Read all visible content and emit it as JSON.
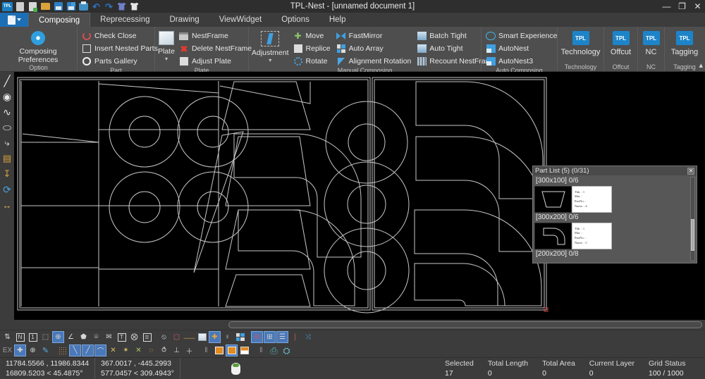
{
  "window": {
    "title": "TPL-Nest - [unnamed document 1]",
    "quick_access": [
      {
        "name": "tpl-logo-icon",
        "label": "TPL"
      },
      {
        "name": "new-document-icon",
        "label": "New"
      },
      {
        "name": "new-part-icon",
        "label": "New Part"
      },
      {
        "name": "open-folder-icon",
        "label": "Open"
      },
      {
        "name": "save-icon",
        "label": "Save"
      },
      {
        "name": "save-as-icon",
        "label": "Save As"
      },
      {
        "name": "print-icon",
        "label": "Print"
      },
      {
        "name": "undo-icon",
        "label": "Undo"
      },
      {
        "name": "redo-icon",
        "label": "Redo"
      },
      {
        "name": "import-icon",
        "label": "Import"
      },
      {
        "name": "export-icon",
        "label": "Export"
      }
    ],
    "controls": {
      "minimize": "—",
      "restore": "❐",
      "close": "✕"
    }
  },
  "tabs": [
    {
      "label": "Composing",
      "active": true
    },
    {
      "label": "Reprecessing",
      "active": false
    },
    {
      "label": "Drawing",
      "active": false
    },
    {
      "label": "ViewWidget",
      "active": false
    },
    {
      "label": "Options",
      "active": false
    },
    {
      "label": "Help",
      "active": false
    }
  ],
  "ribbon": {
    "groups": [
      {
        "title": "Option",
        "big": {
          "label": "Composing Preferences",
          "icon": "gear-icon"
        }
      },
      {
        "title": "Part",
        "items": [
          {
            "label": "Check Close",
            "icon": "circular-arrow-icon"
          },
          {
            "label": "Insert Nested Parts",
            "icon": "insert-parts-icon"
          },
          {
            "label": "Parts Gallery",
            "icon": "ring-icon"
          }
        ]
      },
      {
        "title": "Plate",
        "big": {
          "label": "Plate",
          "icon": "plate-icon"
        },
        "items": [
          {
            "label": "NestFrame",
            "icon": "nestframe-icon"
          },
          {
            "label": "Delete NestFrame",
            "icon": "delete-x-icon"
          },
          {
            "label": "Adjust Plate",
            "icon": "adjust-plate-icon"
          }
        ]
      },
      {
        "title": "Manual Composing",
        "big": {
          "label": "Adjustment",
          "icon": "adjustment-icon"
        },
        "col1": [
          {
            "label": "Move",
            "icon": "move-icon"
          },
          {
            "label": "Replice",
            "icon": "replice-icon"
          },
          {
            "label": "Rotate",
            "icon": "rotate-icon"
          }
        ],
        "col2": [
          {
            "label": "FastMirror",
            "icon": "mirror-icon"
          },
          {
            "label": "Auto Array",
            "icon": "array-icon"
          },
          {
            "label": "Alignment Rotation",
            "icon": "alignment-rotation-icon"
          }
        ],
        "col3": [
          {
            "label": "Batch Tight",
            "icon": "batch-tight-icon"
          },
          {
            "label": "Auto Tight",
            "icon": "auto-tight-icon"
          },
          {
            "label": "Recount NestFrame",
            "icon": "recount-icon"
          }
        ]
      },
      {
        "title": "Auto Composing",
        "items": [
          {
            "label": "Smart Experience",
            "icon": "cloud-icon"
          },
          {
            "label": "AutoNest",
            "icon": "autonest-icon"
          },
          {
            "label": "AutoNest3",
            "icon": "autonest3-icon"
          }
        ]
      },
      {
        "title": "Technology",
        "tpl": {
          "label": "Technology",
          "badge": "TPL"
        }
      },
      {
        "title": "Offcut",
        "tpl": {
          "label": "Offcut",
          "badge": "TPL"
        }
      },
      {
        "title": "NC",
        "tpl": {
          "label": "NC",
          "badge": "TPL"
        }
      },
      {
        "title": "Tagging",
        "tpl": {
          "label": "Tagging",
          "badge": "TPL"
        }
      }
    ],
    "collapse_icon": "chevron-up-icon"
  },
  "left_toolbar": [
    {
      "name": "line-tool",
      "glyph": "╱"
    },
    {
      "name": "circle-tool",
      "glyph": "◉"
    },
    {
      "name": "spline-tool",
      "glyph": "∿"
    },
    {
      "name": "ellipse-tool",
      "glyph": "⬭"
    },
    {
      "name": "arc-tool",
      "glyph": "⤷"
    },
    {
      "name": "text-tool",
      "glyph": "▤"
    },
    {
      "name": "dimension-tool",
      "glyph": "↧"
    },
    {
      "name": "rotate-tool",
      "glyph": "⟳"
    },
    {
      "name": "measure-tool",
      "glyph": "↔"
    }
  ],
  "part_list": {
    "title": "Part List (5) (0/31)",
    "close_glyph": "✕",
    "groups": [
      {
        "size_label": "[300x100] 0/6",
        "info": {
          "thk": "Thk. :  1",
          "mat": "Mat. :",
          "partno": "PartNo. :",
          "name": "Name. :  4"
        },
        "shape": "trapezoid"
      },
      {
        "size_label": "[300x200] 0/6",
        "info": {
          "thk": "Thk. :  1",
          "mat": "Mat. :",
          "partno": "PartNo. :",
          "name": "Name. :  5"
        },
        "shape": "elbow"
      },
      {
        "size_label": "[200x200] 0/8",
        "info": null,
        "shape": null
      }
    ]
  },
  "bottom_toolbar_row1": [
    {
      "name": "snap-toggle-icon",
      "glyph": "⇅",
      "active": false
    },
    {
      "name": "ortho-n-icon",
      "glyph": "N",
      "active": false
    },
    {
      "name": "layer-1-icon",
      "glyph": "1",
      "active": false
    },
    {
      "name": "selection-box-icon",
      "glyph": "⬚",
      "active": false
    },
    {
      "name": "center-snap-icon",
      "glyph": "⊕",
      "active": true
    },
    {
      "name": "angle-icon",
      "glyph": "∠",
      "active": false
    },
    {
      "name": "polygon-icon",
      "glyph": "⬟",
      "active": false
    },
    {
      "name": "tag-box-icon",
      "glyph": "⌾",
      "active": false
    },
    {
      "name": "envelope-icon",
      "glyph": "✉",
      "active": false
    },
    {
      "name": "text-box-icon",
      "glyph": "T",
      "active": false
    },
    {
      "name": "crosshair-circle-icon",
      "glyph": "⨂",
      "active": false
    },
    {
      "name": "table-icon",
      "glyph": "≣",
      "active": false
    },
    {
      "name": "hide-icon",
      "glyph": "⦸",
      "active": false
    },
    {
      "name": "bbox-icon",
      "glyph": "▢",
      "active": false
    },
    {
      "name": "zigzag-icon",
      "glyph": "⸺",
      "active": false
    },
    {
      "name": "fill-icon",
      "glyph": "■",
      "active": false
    },
    {
      "name": "lead-icon",
      "glyph": "✚",
      "active": true
    },
    {
      "name": "pin-icon",
      "glyph": "♀",
      "active": false
    },
    {
      "name": "grid-blocks-icon",
      "glyph": "∷",
      "active": false
    },
    {
      "name": "no-display-icon",
      "glyph": "⊘",
      "active": true
    },
    {
      "name": "grid-view-icon",
      "glyph": "⊞",
      "active": true
    },
    {
      "name": "note-icon",
      "glyph": "☰",
      "active": true
    },
    {
      "name": "marker-icon",
      "glyph": "❘",
      "active": false
    },
    {
      "name": "shuffle-icon",
      "glyph": "⤨",
      "active": false
    }
  ],
  "bottom_toolbar_row2": [
    {
      "name": "extend-label",
      "glyph": "EX",
      "active": false
    },
    {
      "name": "crosshair-icon",
      "glyph": "✚",
      "active": true
    },
    {
      "name": "target-icon",
      "glyph": "⊕",
      "active": false
    },
    {
      "name": "pencil-icon",
      "glyph": "✎",
      "active": false
    },
    {
      "name": "dot-grid-icon",
      "glyph": "∷",
      "active": false
    },
    {
      "name": "line-snap1-icon",
      "glyph": "╲",
      "active": true
    },
    {
      "name": "line-snap2-icon",
      "glyph": "╱",
      "active": true
    },
    {
      "name": "curve-snap-icon",
      "glyph": "⌒",
      "active": true
    },
    {
      "name": "trim-icon",
      "glyph": "✕",
      "active": false
    },
    {
      "name": "extend-icon",
      "glyph": "✶",
      "active": false
    },
    {
      "name": "intersect-icon",
      "glyph": "✕",
      "active": false
    },
    {
      "name": "circle-snap-icon",
      "glyph": "◌",
      "active": false
    },
    {
      "name": "arc-mid-icon",
      "glyph": "⥀",
      "active": false
    },
    {
      "name": "perp-icon",
      "glyph": "⊥",
      "active": false
    },
    {
      "name": "plus-icon",
      "glyph": "＋",
      "active": false
    },
    {
      "name": "bar-icon",
      "glyph": "‖",
      "active": false
    },
    {
      "name": "orange-box1-icon",
      "glyph": "",
      "active": false
    },
    {
      "name": "orange-box2-icon",
      "glyph": "",
      "active": true
    },
    {
      "name": "orange-box3-icon",
      "glyph": "",
      "active": false
    },
    {
      "name": "ruler-icon",
      "glyph": "‖",
      "active": false
    },
    {
      "name": "machine-icon",
      "glyph": "⎙",
      "active": false
    },
    {
      "name": "building-icon",
      "glyph": "⛭",
      "active": false
    }
  ],
  "status_bar": {
    "coords": {
      "line1": "11784.5566 , 11986.8344",
      "line2": "16809.5203 < 45.4875°"
    },
    "delta": {
      "line1": "367.0017 , -445.2993",
      "line2": "577.0457 < 309.4943°"
    },
    "mouse_icon": "mouse-icon",
    "stats": [
      {
        "header": "Selected",
        "value": "17"
      },
      {
        "header": "Total Length",
        "value": "0"
      },
      {
        "header": "Total Area",
        "value": "0"
      },
      {
        "header": "Current Layer",
        "value": "0"
      },
      {
        "header": "Grid Status",
        "value": "100 / 1000"
      }
    ]
  },
  "colors": {
    "accent": "#1d84c9",
    "ribbon_bg": "#4e4e4e",
    "chrome_bg": "#3c3c3c",
    "canvas_bg": "#000000",
    "geometry_stroke": "#d0d0d0"
  }
}
